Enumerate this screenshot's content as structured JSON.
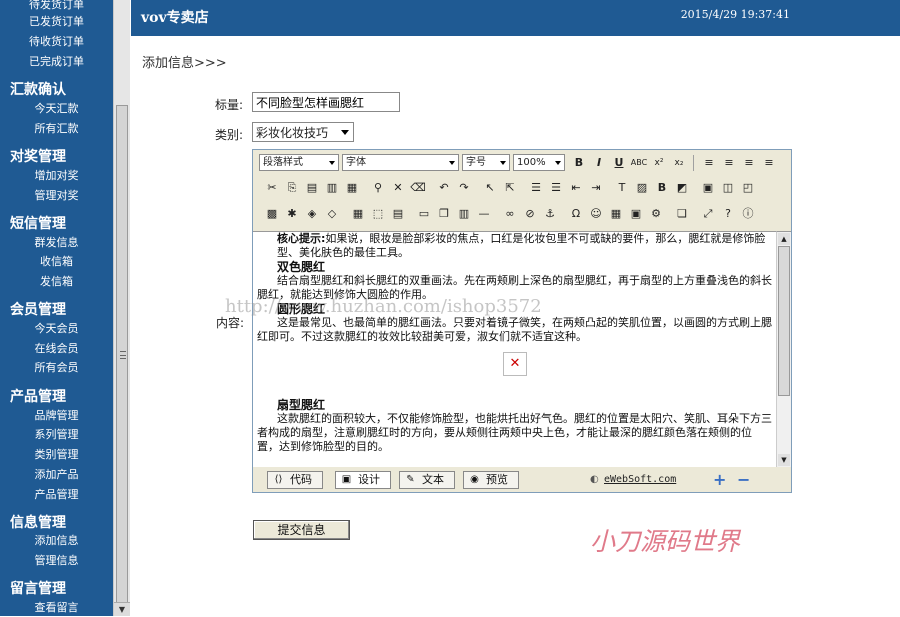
{
  "sidebar": {
    "top_items": [
      "待发货订单",
      "已发货订单",
      "待收货订单",
      "已完成订单"
    ],
    "sections": [
      {
        "title": "汇款确认",
        "items": [
          "今天汇款",
          "所有汇款"
        ]
      },
      {
        "title": "对奖管理",
        "items": [
          "增加对奖",
          "管理对奖"
        ]
      },
      {
        "title": "短信管理",
        "items": [
          "群发信息",
          "收信箱",
          "发信箱"
        ]
      },
      {
        "title": "会员管理",
        "items": [
          "今天会员",
          "在线会员",
          "所有会员"
        ]
      },
      {
        "title": "产品管理",
        "items": [
          "品牌管理",
          "系列管理",
          "类别管理",
          "添加产品",
          "产品管理"
        ]
      },
      {
        "title": "信息管理",
        "items": [
          "添加信息",
          "管理信息"
        ]
      },
      {
        "title": "留言管理",
        "items": [
          "查看留言"
        ]
      }
    ]
  },
  "header": {
    "store_name": "vov专卖店",
    "datetime": "2015/4/29 19:37:41"
  },
  "page": {
    "heading": "添加信息>>>"
  },
  "form": {
    "title_label": "标量:",
    "title_value": "不同脸型怎样画腮红",
    "category_label": "类别:",
    "category_value": "彩妆化妆技巧",
    "content_label": "内容:",
    "submit_label": "提交信息"
  },
  "editor": {
    "para_style": "段落样式",
    "font": "字体",
    "font_size": "字号",
    "zoom": "100%",
    "modes": [
      "代码",
      "设计",
      "文本",
      "预览"
    ],
    "active_mode": "设计",
    "vendor": "eWebSoft.com",
    "content": {
      "intro_lead": "核心提示:",
      "intro": "如果说，眼妆是脸部彩妆的焦点，口红是化妆包里不可或缺的要件，那么，腮红就是修饰脸型、美化肤色的最佳工具。",
      "s1_title": "双色腮红",
      "s1_text": "结合扇型腮红和斜长腮红的双重画法。先在两颊刷上深色的扇型腮红，再于扇型的上方重叠浅色的斜长腮红，就能达到修饰大圆脸的作用。",
      "s2_title": "圆形腮红",
      "s2_text": "这是最常见、也最简单的腮红画法。只要对着镜子微笑，在两颊凸起的笑肌位置，以画圆的方式刷上腮红即可。不过这款腮红的妆效比较甜美可爱，淑女们就不适宜这种。",
      "s3_title": "扇型腮红",
      "s3_text": "这款腮红的面积较大，不仅能修饰脸型，也能烘托出好气色。腮红的位置是太阳穴、笑肌、耳朵下方三者构成的扇型，注意刷腮红时的方向，要从颊侧往两颊中央上色，才能让最深的腮红颜色落在颊侧的位置，达到修饰脸型的目的。"
    }
  },
  "watermarks": {
    "url": "http://www.huzhan.com/ishop3572",
    "brand": "小刀源码世界"
  },
  "colors": {
    "sidebar_bg": "#1f5a93",
    "topbar_bg": "#1f5a93",
    "brand_watermark": "#e07a8a"
  }
}
